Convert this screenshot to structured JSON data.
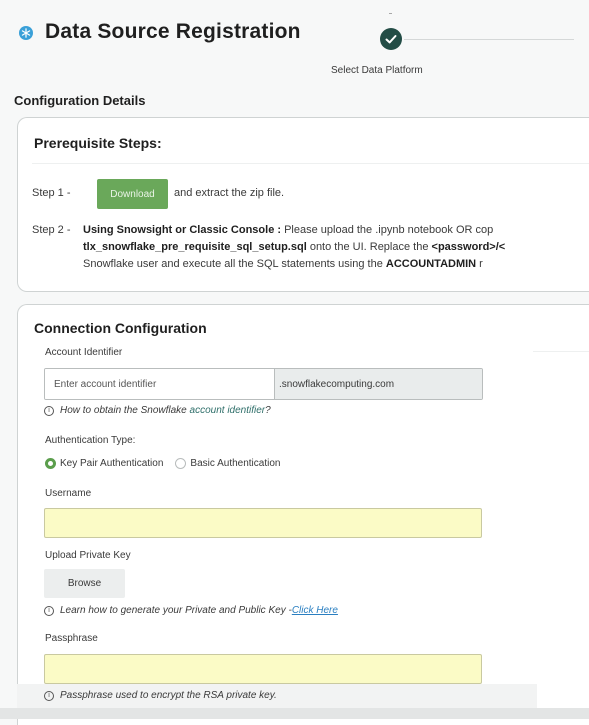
{
  "header": {
    "title": "Data Source Registration",
    "icon": "snowflake-icon",
    "stepper": {
      "current_step_label": "Select Data Platform",
      "status": "completed"
    }
  },
  "section_title": "Configuration Details",
  "prerequisites": {
    "title": "Prerequisite Steps:",
    "step1": {
      "number": "Step 1 -",
      "button_label": "Download",
      "after_text": "and extract the zip file."
    },
    "step2": {
      "number": "Step 2 -",
      "line1_bold": "Using Snowsight or Classic Console :",
      "line1_rest": " Please upload the .ipynb notebook OR cop",
      "line2_bold": "tlx_snowflake_pre_requisite_sql_setup.sql",
      "line2_mid": " onto the UI. Replace the ",
      "line2_bold2": "<password>/<",
      "line3_rest": "Snowflake user and execute all the SQL statements using the ",
      "line3_bold": "ACCOUNTADMIN",
      "line3_tail": " r"
    }
  },
  "connection": {
    "title": "Connection Configuration",
    "account_identifier": {
      "label": "Account Identifier",
      "placeholder": "Enter account identifier",
      "value": "",
      "suffix": ".snowflakecomputing.com",
      "help_prefix": "How to obtain the Snowflake ",
      "help_link": "account identifier",
      "help_suffix": "?"
    },
    "auth": {
      "label": "Authentication Type:",
      "options": [
        "Key Pair Authentication",
        "Basic Authentication"
      ],
      "selected": "Key Pair Authentication"
    },
    "username": {
      "label": "Username",
      "value": ""
    },
    "private_key": {
      "label": "Upload Private Key",
      "button_label": "Browse",
      "help_text": "Learn how to generate your Private and Public Key - ",
      "help_link": "Click Here"
    },
    "passphrase": {
      "label": "Passphrase",
      "value": "",
      "help_text": "Passphrase used to encrypt the RSA private key."
    }
  },
  "colors": {
    "download_button": "#6aa85a",
    "radio_selected": "#5b9e4c",
    "step_complete": "#234d46",
    "input_highlight": "#fbfbc6",
    "link": "#2f6f6a"
  }
}
